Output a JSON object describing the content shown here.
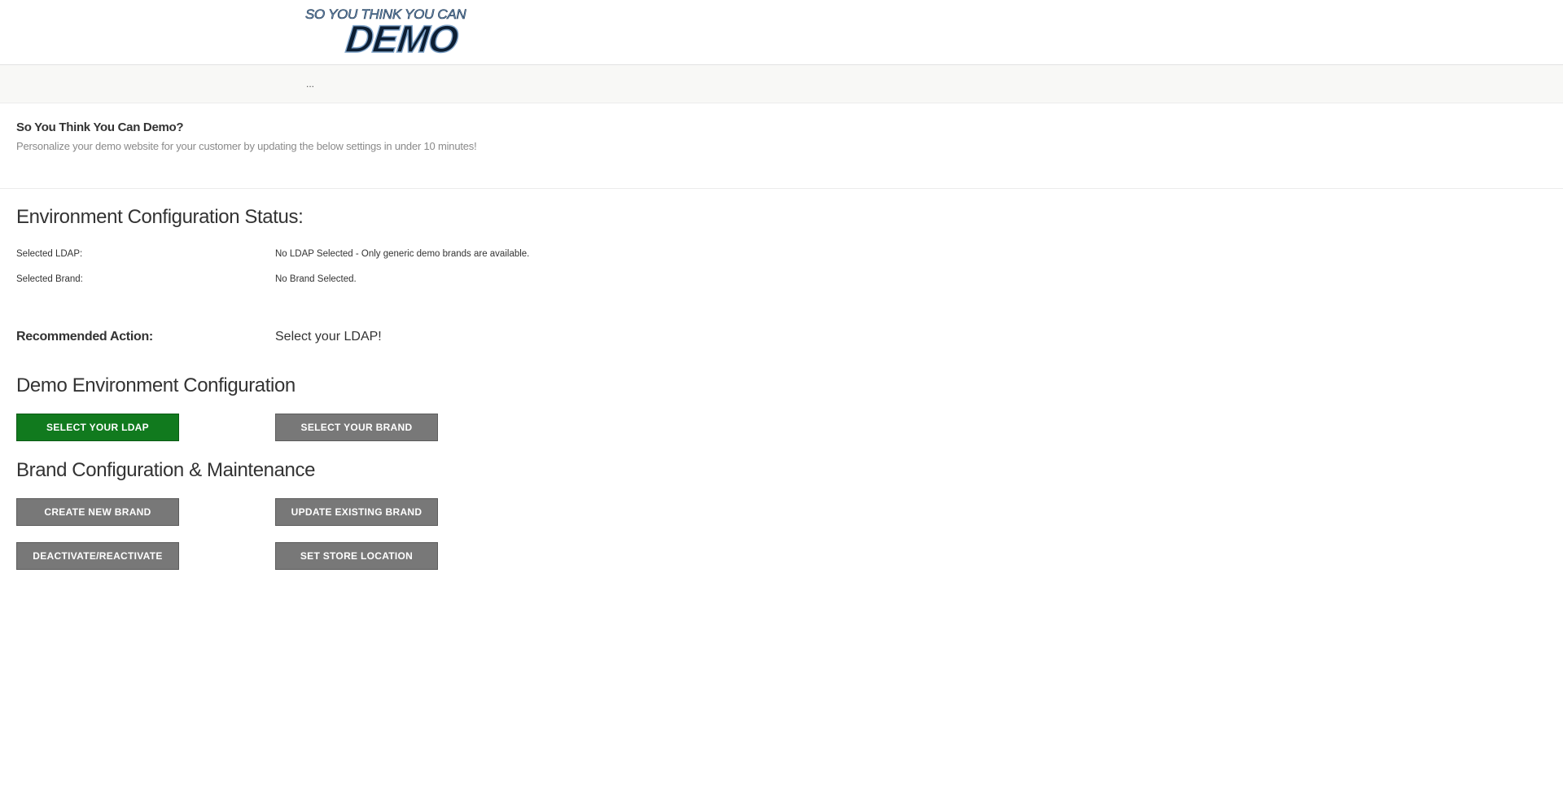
{
  "header": {
    "logo_top": "SO YOU THINK YOU CAN",
    "logo_main": "DEMO"
  },
  "subbar": {
    "text": "..."
  },
  "intro": {
    "title": "So You Think You Can Demo?",
    "subtitle": "Personalize your demo website for your customer by updating the below settings in under 10 minutes!"
  },
  "status": {
    "heading": "Environment Configuration Status:",
    "ldap_label": "Selected LDAP:",
    "ldap_value": "No LDAP Selected - Only generic demo brands are available.",
    "brand_label": "Selected Brand:",
    "brand_value": "No Brand Selected."
  },
  "recommended": {
    "label": "Recommended Action:",
    "value": "Select your LDAP!"
  },
  "demo_env": {
    "heading": "Demo Environment Configuration",
    "select_ldap": "SELECT YOUR LDAP",
    "select_brand": "SELECT YOUR BRAND"
  },
  "brand_config": {
    "heading": "Brand Configuration & Maintenance",
    "create": "CREATE NEW BRAND",
    "update": "UPDATE EXISTING BRAND",
    "deactivate": "DEACTIVATE/REACTIVATE",
    "store_location": "SET STORE LOCATION"
  },
  "colors": {
    "primary_button": "#117a1e",
    "secondary_button": "#787878"
  }
}
